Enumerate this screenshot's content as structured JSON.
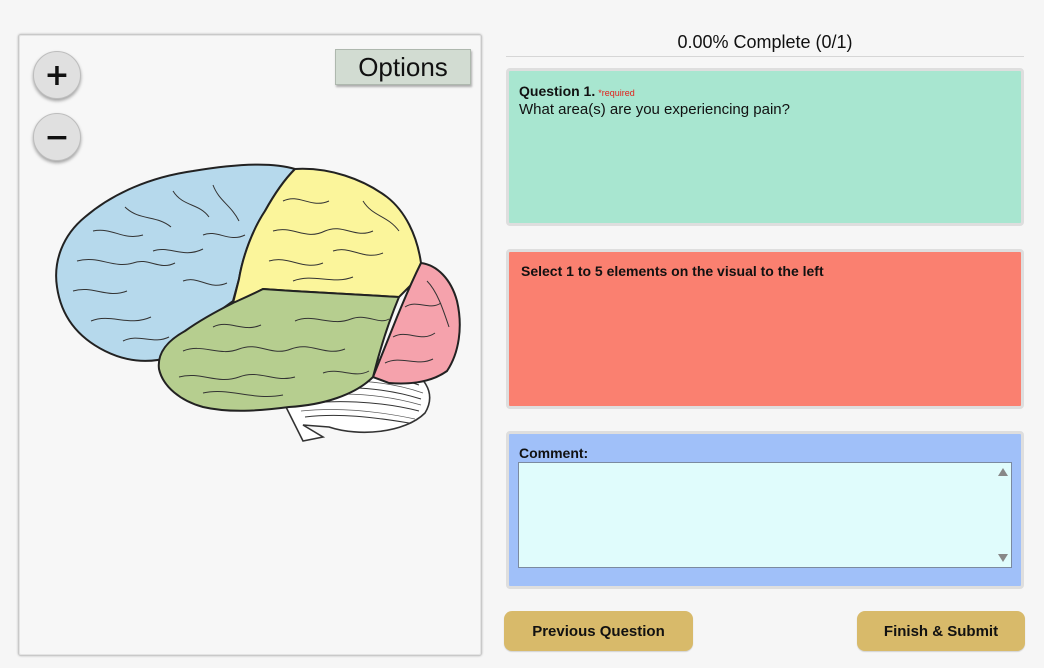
{
  "visual": {
    "zoom_in_label": "+",
    "zoom_out_label": "−",
    "options_label": "Options",
    "regions": [
      {
        "name": "frontal-lobe",
        "color": "#b6d9ec"
      },
      {
        "name": "parietal-lobe",
        "color": "#fbf59b"
      },
      {
        "name": "occipital-lobe",
        "color": "#f5a2ac"
      },
      {
        "name": "temporal-lobe",
        "color": "#b6ce8f"
      },
      {
        "name": "cerebellum",
        "color": "#ffffff"
      }
    ]
  },
  "progress": {
    "text": "0.00% Complete (0/1)"
  },
  "question": {
    "title": "Question 1.",
    "required": "*required",
    "text": "What area(s) are you experiencing pain?"
  },
  "instruction": {
    "text": "Select 1 to 5 elements on the visual to the left"
  },
  "comment": {
    "label": "Comment:",
    "value": ""
  },
  "nav": {
    "prev_label": "Previous Question",
    "submit_label": "Finish & Submit"
  },
  "colors": {
    "question_bg": "#a8e6d0",
    "instruction_bg": "#fa8070",
    "comment_bg": "#a0c0f9",
    "button_bg": "#d8ba6a"
  }
}
